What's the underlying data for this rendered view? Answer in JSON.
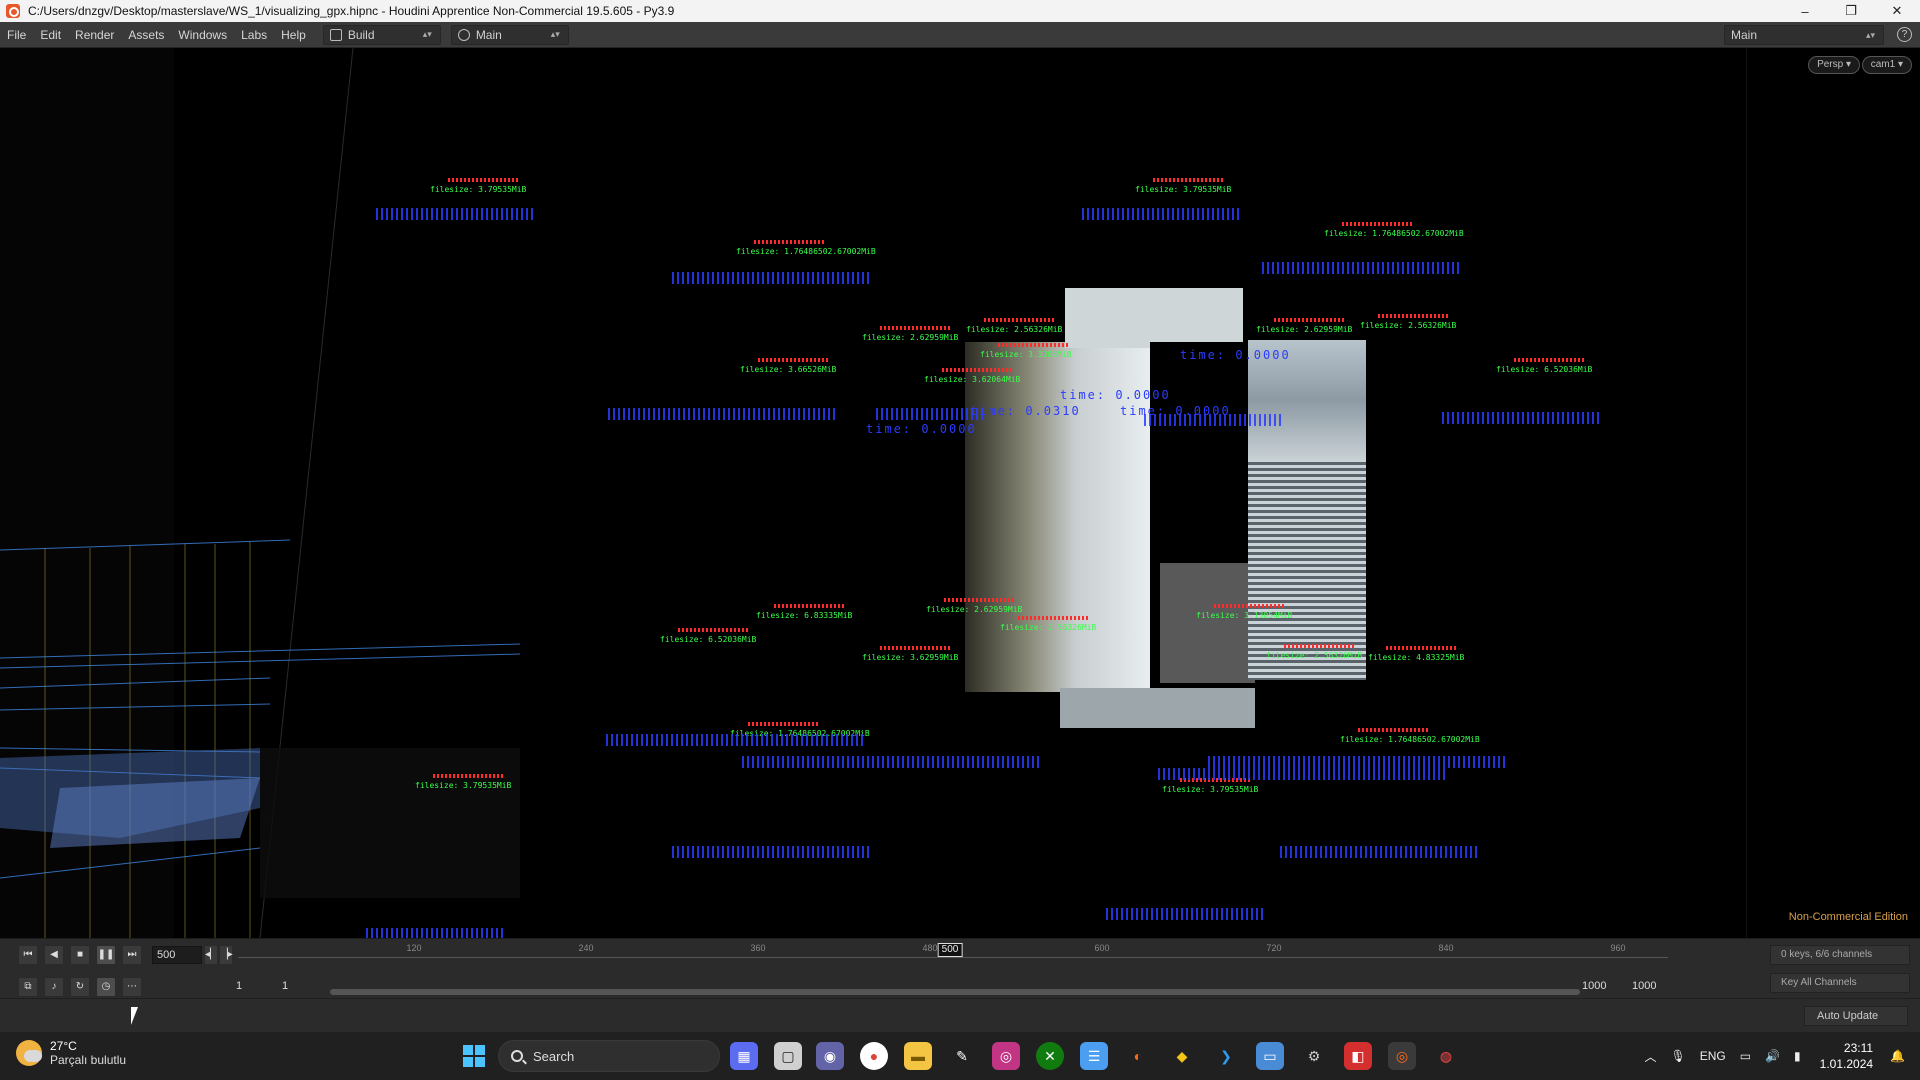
{
  "window": {
    "title": "C:/Users/dnzgv/Desktop/masterslave/WS_1/visualizing_gpx.hipnc - Houdini Apprentice Non-Commercial 19.5.605 - Py3.9",
    "minimize": "–",
    "maximize": "❐",
    "close": "✕"
  },
  "menu": {
    "items": [
      "File",
      "Edit",
      "Render",
      "Assets",
      "Windows",
      "Labs",
      "Help"
    ],
    "desktop_left": "Build",
    "desktop_right": "Main",
    "desktop_far_right": "Main",
    "help": "?"
  },
  "viewport": {
    "persp": "Persp ▾",
    "cam": "cam1 ▾",
    "non_commercial": "Non-Commercial Edition",
    "colors": {
      "red": "#ff2a2a",
      "green": "#39ff4a",
      "blue": "#2a3cff"
    },
    "labels": [
      {
        "text": "filesize: 3.79535MiB"
      },
      {
        "text": "filesize: 3.79535MiB"
      },
      {
        "text": "filesize: 1.76486502.67002MiB"
      },
      {
        "text": "filesize: 1.76486502.67002MiB"
      },
      {
        "text": "filesize: 2.62959MiB"
      },
      {
        "text": "filesize: 2.56326MiB"
      },
      {
        "text": "filesize: 2.62959MiB"
      },
      {
        "text": "filesize: 2.56326MiB"
      },
      {
        "text": "filesize: 6.52036MiB"
      },
      {
        "text": "filesize: 3.66526MiB"
      },
      {
        "text": "filesize: 3.62064MiB"
      },
      {
        "text": "filesize: 3.3205MiB"
      },
      {
        "text": "filesize: 1.76486502.67002MiB"
      },
      {
        "text": "filesize: 1.76486502.67002MiB"
      },
      {
        "text": "filesize: 3.79535MiB"
      },
      {
        "text": "filesize: 3.79535MiB"
      },
      {
        "text": "filesize: 3.62959MiB"
      },
      {
        "text": "filesize: 2.56326MiB"
      },
      {
        "text": "filesize: 6.52036MiB"
      },
      {
        "text": "filesize: 6.83335MiB"
      },
      {
        "text": "filesize: 2.62959MiB"
      },
      {
        "text": "filesize: 2.56326MiB"
      },
      {
        "text": "filesize: 3.13054MiB"
      },
      {
        "text": "filesize: 4.83325MiB"
      }
    ],
    "blue_texts": [
      {
        "text": "time: 0.0000"
      },
      {
        "text": "time: 0.0000"
      },
      {
        "text": "time: 0.0000"
      },
      {
        "text": "time: 0.0000"
      },
      {
        "text": "time: 0.0310"
      }
    ]
  },
  "playbar": {
    "current_frame": "500",
    "tick_labels": [
      "120",
      "240",
      "360",
      "480",
      "600",
      "720",
      "840",
      "960"
    ],
    "cursor_label": "500",
    "start_field": "1",
    "start_field2": "1",
    "end_field": "1000",
    "end_field2": "1000",
    "keys_info": "0 keys, 6/6 channels",
    "key_all": "Key All Channels",
    "auto_update": "Auto Update",
    "icons": {
      "first": "⏮",
      "prev": "◀",
      "stop": "■",
      "pause": "❚❚",
      "last": "⏭",
      "step_back": "◂▏",
      "step_fwd": "▕▸"
    }
  },
  "taskbar": {
    "temp": "27°C",
    "condition": "Parçalı bulutlu",
    "search": "Search",
    "lang": "ENG",
    "time": "23:11",
    "date": "1.01.2024"
  }
}
